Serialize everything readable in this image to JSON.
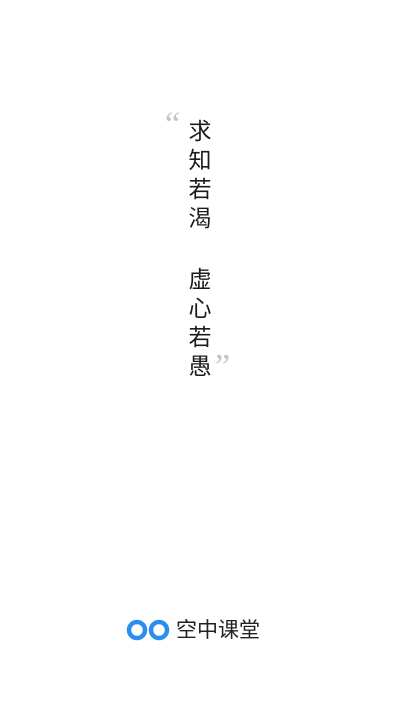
{
  "quote": {
    "open_mark": "“",
    "close_mark": "”",
    "line1": [
      "求",
      "知",
      "若",
      "渴"
    ],
    "line2": [
      "虚",
      "心",
      "若",
      "愚"
    ]
  },
  "brand": {
    "name": "空中课堂",
    "logo_icon": "infinity-rings-icon",
    "logo_color": "#2a8ef0"
  }
}
